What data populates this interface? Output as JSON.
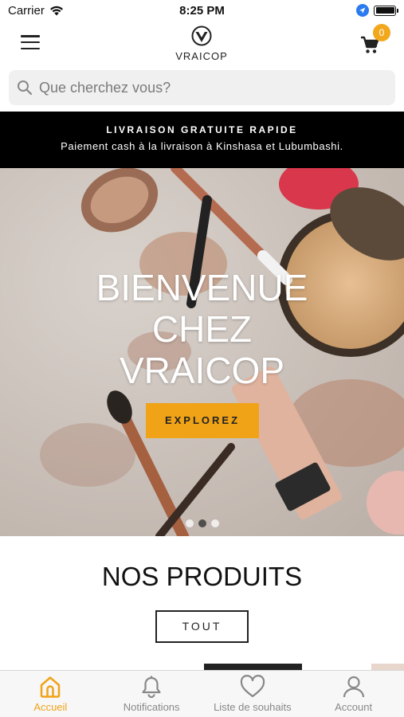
{
  "status_bar": {
    "carrier": "Carrier",
    "time": "8:25 PM"
  },
  "header": {
    "logo_text": "VRAICOP",
    "cart_count": "0"
  },
  "search": {
    "placeholder": "Que cherchez vous?"
  },
  "promo": {
    "title": "LIVRAISON GRATUITE RAPIDE",
    "subtitle": "Paiement cash à la livraison à Kinshasa et Lubumbashi."
  },
  "hero": {
    "title_lines": [
      "BIENVENUE",
      "CHEZ",
      "VRAICOP"
    ],
    "button_label": "EXPLOREZ",
    "slide_count": 3,
    "active_slide": 2
  },
  "products": {
    "title": "NOS PRODUITS",
    "button_label": "TOUT"
  },
  "tabbar": {
    "items": [
      {
        "label": "Accueil",
        "icon": "home-icon",
        "active": true
      },
      {
        "label": "Notifications",
        "icon": "bell-icon",
        "active": false
      },
      {
        "label": "Liste de souhaits",
        "icon": "heart-icon",
        "active": false
      },
      {
        "label": "Account",
        "icon": "user-icon",
        "active": false
      }
    ]
  },
  "colors": {
    "accent": "#f0a317",
    "promo_bg": "#000000",
    "inactive_tab": "#888888"
  }
}
